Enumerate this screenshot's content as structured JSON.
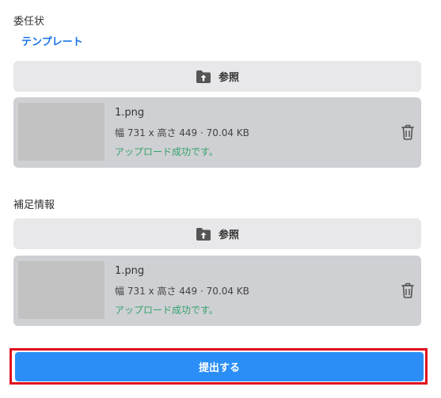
{
  "colors": {
    "link": "#1a73e8",
    "success": "#34a36b",
    "submit_bg": "#2a8ef6",
    "highlight": "#e0101e",
    "icon": "#555555"
  },
  "proxy_section": {
    "label": "委任状",
    "template_link": "テンプレート",
    "browse_label": "参照",
    "browse_icon": "folder-upload-icon",
    "file": {
      "name": "1.png",
      "meta": "幅 731 x 高さ 449 · 70.04 KB",
      "status": "アップロード成功です。",
      "delete_icon": "trash-icon"
    }
  },
  "supplement_section": {
    "label": "補足情報",
    "browse_label": "参照",
    "browse_icon": "folder-upload-icon",
    "file": {
      "name": "1.png",
      "meta": "幅 731 x 高さ 449 · 70.04 KB",
      "status": "アップロード成功です。",
      "delete_icon": "trash-icon"
    }
  },
  "submit": {
    "label": "提出する"
  }
}
